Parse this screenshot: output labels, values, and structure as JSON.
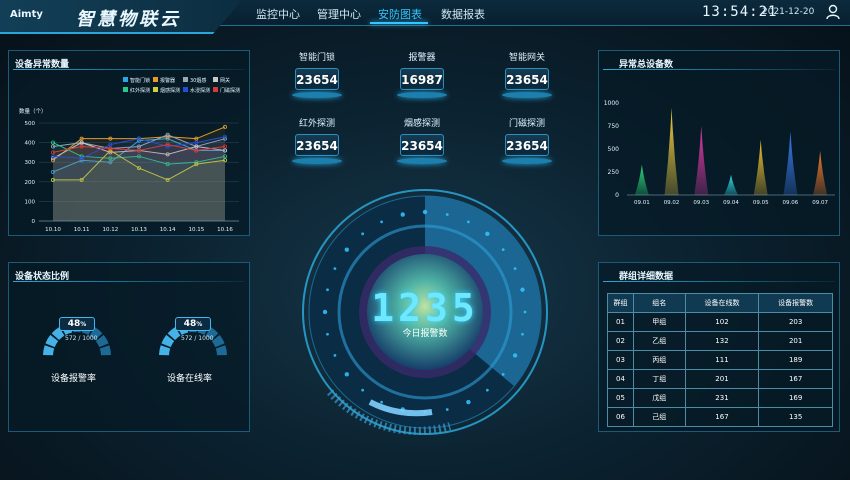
{
  "header": {
    "brand_small": "Aimty",
    "brand_big": "智慧物联云",
    "nav": [
      "监控中心",
      "管理中心",
      "安防图表",
      "数据报表"
    ],
    "active_nav": "安防图表",
    "time": "13:54:21",
    "date": "2021-12-20",
    "accent": "#35c6ff"
  },
  "left_top": {
    "title": "设备异常数量",
    "ylabel": "数量（个）"
  },
  "line_chart": {
    "type": "line",
    "x": [
      "10.10",
      "10.11",
      "10.12",
      "10.13",
      "10.14",
      "10.15",
      "10.16"
    ],
    "ylim": [
      0,
      500
    ],
    "yticks": [
      "0",
      "100",
      "200",
      "300",
      "400",
      "500"
    ],
    "legend_placement": "top",
    "series": [
      {
        "name": "智能门锁",
        "color": "#2aa7e8",
        "values": [
          250,
          310,
          300,
          410,
          420,
          360,
          360
        ]
      },
      {
        "name": "报警器",
        "color": "#e69a2c",
        "values": [
          310,
          420,
          420,
          420,
          430,
          420,
          480
        ]
      },
      {
        "name": "30烟感",
        "color": "#9aa7b4",
        "values": [
          380,
          400,
          370,
          380,
          440,
          380,
          420
        ]
      },
      {
        "name": "网关",
        "color": "#c8c8c8",
        "values": [
          320,
          400,
          350,
          360,
          340,
          380,
          360
        ]
      },
      {
        "name": "红外探测",
        "color": "#27c88a",
        "values": [
          400,
          330,
          320,
          330,
          290,
          300,
          330
        ]
      },
      {
        "name": "烟感探测",
        "color": "#c9d23a",
        "values": [
          210,
          210,
          360,
          270,
          210,
          290,
          310
        ]
      },
      {
        "name": "水浸探测",
        "color": "#2050d8",
        "values": [
          330,
          320,
          390,
          420,
          380,
          400,
          430
        ]
      },
      {
        "name": "门磁探测",
        "color": "#d83a3a",
        "values": [
          350,
          380,
          370,
          360,
          390,
          360,
          380
        ]
      }
    ]
  },
  "devices": [
    {
      "label": "智能门锁",
      "value": "23654"
    },
    {
      "label": "报警器",
      "value": "16987"
    },
    {
      "label": "智能网关",
      "value": "23654"
    },
    {
      "label": "红外探测",
      "value": "23654"
    },
    {
      "label": "烟感探测",
      "value": "23654"
    },
    {
      "label": "门磁探测",
      "value": "23654"
    }
  ],
  "center": {
    "big_number": "1235",
    "caption": "今日报警数"
  },
  "right_top": {
    "title": "异常总设备数"
  },
  "chart_data": {
    "type": "bar",
    "categories": [
      "09.01",
      "09.02",
      "09.03",
      "09.04",
      "09.05",
      "09.06",
      "09.07"
    ],
    "values": [
      330,
      950,
      750,
      220,
      600,
      690,
      480
    ],
    "ylim": [
      0,
      1000
    ],
    "yticks": [
      "0",
      "250",
      "500",
      "750",
      "1000"
    ],
    "colors": [
      "#2bd97a",
      "#f5d040",
      "#e23aa8",
      "#34d8e8",
      "#f0c030",
      "#3a7cf0",
      "#f07a2a"
    ]
  },
  "left_bottom": {
    "title": "设备状态比例",
    "gauges": [
      {
        "percent": "48",
        "unit": "%",
        "sub": "572 / 1000",
        "label": "设备报警率"
      },
      {
        "percent": "48",
        "unit": "%",
        "sub": "572 / 1000",
        "label": "设备在线率"
      }
    ]
  },
  "right_bottom": {
    "title": "群组详细数据",
    "columns": [
      "群组",
      "组名",
      "设备在线数",
      "设备报警数"
    ],
    "rows": [
      [
        "01",
        "甲组",
        "102",
        "203"
      ],
      [
        "02",
        "乙组",
        "132",
        "201"
      ],
      [
        "03",
        "丙组",
        "111",
        "189"
      ],
      [
        "04",
        "丁组",
        "201",
        "167"
      ],
      [
        "05",
        "戊组",
        "231",
        "169"
      ],
      [
        "06",
        "己组",
        "167",
        "135"
      ]
    ]
  }
}
